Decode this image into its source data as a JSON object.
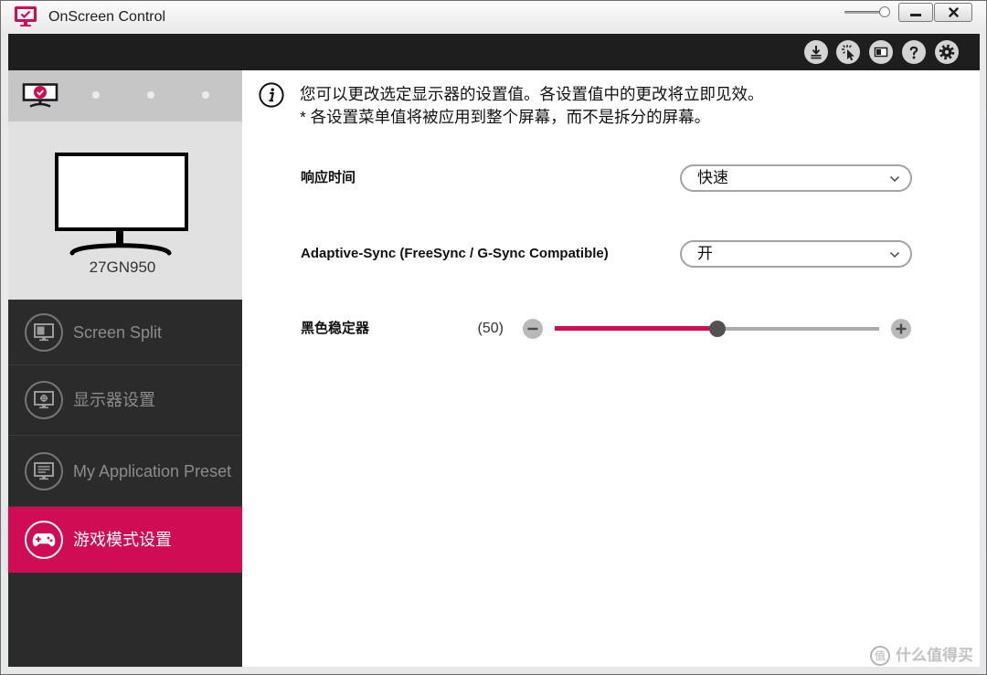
{
  "window": {
    "title": "OnScreen Control",
    "app_icon": "onscreen-control-icon",
    "minimize_icon": "minimize-icon",
    "close_icon": "close-icon"
  },
  "toolbar": {
    "buttons": [
      {
        "icon": "download-icon"
      },
      {
        "icon": "cursor-click-icon"
      },
      {
        "icon": "display-mode-icon"
      },
      {
        "icon": "help-icon"
      },
      {
        "icon": "settings-icon"
      }
    ]
  },
  "sidebar": {
    "monitor_tabs": [
      {
        "icon": "monitor-check-icon",
        "selected": true
      },
      {
        "icon": "empty-slot-dot",
        "selected": false
      },
      {
        "icon": "empty-slot-dot",
        "selected": false
      },
      {
        "icon": "empty-slot-dot",
        "selected": false
      }
    ],
    "preview": {
      "icon": "monitor-outline-icon",
      "model": "27GN950"
    },
    "menu": [
      {
        "label": "Screen Split",
        "icon": "screen-split-icon",
        "selected": false
      },
      {
        "label": "显示器设置",
        "icon": "monitor-settings-icon",
        "selected": false
      },
      {
        "label": "My Application Preset",
        "icon": "app-preset-icon",
        "selected": false
      },
      {
        "label": "游戏模式设置",
        "icon": "gamepad-icon",
        "selected": true
      }
    ]
  },
  "main": {
    "info": {
      "icon": "info-icon",
      "lines": [
        "您可以更改选定显示器的设置值。各设置值中的更改将立即见效。",
        "* 各设置菜单值将被应用到整个屏幕，而不是拆分的屏幕。"
      ]
    },
    "settings": {
      "response_time": {
        "label": "响应时间",
        "value": "快速",
        "icon": "chevron-down-icon"
      },
      "adaptive_sync": {
        "label": "Adaptive-Sync (FreeSync / G-Sync Compatible)",
        "value": "开",
        "icon": "chevron-down-icon"
      },
      "black_stabilizer": {
        "label": "黑色稳定器",
        "value_text": "(50)",
        "level_percent": 50
      }
    }
  },
  "watermark": {
    "logo_text": "值",
    "text": "什么值得买"
  },
  "colors": {
    "accent": "#d00c55",
    "toolbar_bg": "#1e1e1e",
    "menu_bg": "#2b2b2b",
    "preview_bg": "#e1e1e1",
    "tab_strip_bg": "#c6c6c6"
  }
}
